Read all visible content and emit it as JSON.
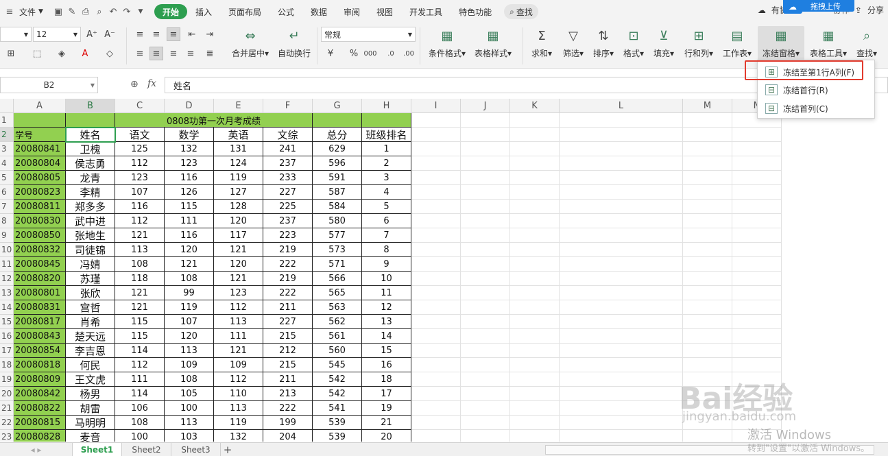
{
  "menubar": {
    "file_label": "文件",
    "tabs": [
      "开始",
      "插入",
      "页面布局",
      "公式",
      "数据",
      "审阅",
      "视图",
      "开发工具",
      "特色功能"
    ],
    "search_label": "查找",
    "collab_label": "有协",
    "share_label": "分享",
    "partial_label": "协作",
    "upload_label": "拖拽上传"
  },
  "ribbon": {
    "font_size": "12",
    "number_format": "常规",
    "merge_label": "合并居中",
    "wrap_label": "自动换行",
    "cond_format_label": "条件格式",
    "table_style_label": "表格样式",
    "sum_label": "求和",
    "filter_label": "筛选",
    "sort_label": "排序",
    "format_label": "格式",
    "fill_label": "填充",
    "rowcol_label": "行和列",
    "sheet_label": "工作表",
    "freeze_label": "冻结窗格",
    "tools_label": "表格工具",
    "find_label": "查找",
    "currency": "¥",
    "percent": "%",
    "thousands": "000"
  },
  "formula_bar": {
    "cell_ref": "B2",
    "fx": "fx",
    "content": "姓名"
  },
  "dropdown": {
    "items": [
      "冻结至第1行A列(F)",
      "冻结首行(R)",
      "冻结首列(C)"
    ]
  },
  "columns": [
    "A",
    "B",
    "C",
    "D",
    "E",
    "F",
    "G",
    "H",
    "I",
    "J",
    "K",
    "L",
    "M",
    "N"
  ],
  "sheet": {
    "title": "0808功第一次月考成绩",
    "headers": [
      "学号",
      "姓名",
      "语文",
      "数学",
      "英语",
      "文综",
      "总分",
      "班级排名"
    ],
    "rows": [
      [
        "20080841",
        "卫槐",
        "125",
        "132",
        "131",
        "241",
        "629",
        "1"
      ],
      [
        "20080804",
        "侯志勇",
        "112",
        "123",
        "124",
        "237",
        "596",
        "2"
      ],
      [
        "20080805",
        "龙青",
        "123",
        "116",
        "119",
        "233",
        "591",
        "3"
      ],
      [
        "20080823",
        "李精",
        "107",
        "126",
        "127",
        "227",
        "587",
        "4"
      ],
      [
        "20080811",
        "郑多多",
        "116",
        "115",
        "128",
        "225",
        "584",
        "5"
      ],
      [
        "20080830",
        "武中进",
        "112",
        "111",
        "120",
        "237",
        "580",
        "6"
      ],
      [
        "20080850",
        "张地生",
        "121",
        "116",
        "117",
        "223",
        "577",
        "7"
      ],
      [
        "20080832",
        "司徒锦",
        "113",
        "120",
        "121",
        "219",
        "573",
        "8"
      ],
      [
        "20080845",
        "冯婧",
        "108",
        "121",
        "120",
        "222",
        "571",
        "9"
      ],
      [
        "20080820",
        "苏瑾",
        "118",
        "108",
        "121",
        "219",
        "566",
        "10"
      ],
      [
        "20080801",
        "张欣",
        "121",
        "99",
        "123",
        "222",
        "565",
        "11"
      ],
      [
        "20080831",
        "宫哲",
        "121",
        "119",
        "112",
        "211",
        "563",
        "12"
      ],
      [
        "20080817",
        "肖希",
        "115",
        "107",
        "113",
        "227",
        "562",
        "13"
      ],
      [
        "20080843",
        "楚天远",
        "115",
        "120",
        "111",
        "215",
        "561",
        "14"
      ],
      [
        "20080854",
        "李吉恩",
        "114",
        "113",
        "121",
        "212",
        "560",
        "15"
      ],
      [
        "20080818",
        "何民",
        "112",
        "109",
        "109",
        "215",
        "545",
        "16"
      ],
      [
        "20080809",
        "王文虎",
        "111",
        "108",
        "112",
        "211",
        "542",
        "18"
      ],
      [
        "20080842",
        "杨男",
        "114",
        "105",
        "110",
        "213",
        "542",
        "17"
      ],
      [
        "20080822",
        "胡雷",
        "106",
        "100",
        "113",
        "222",
        "541",
        "19"
      ],
      [
        "20080815",
        "马明明",
        "108",
        "113",
        "119",
        "199",
        "539",
        "21"
      ],
      [
        "20080828",
        "麦音",
        "100",
        "103",
        "132",
        "204",
        "539",
        "20"
      ]
    ]
  },
  "sheet_tabs": [
    "Sheet1",
    "Sheet2",
    "Sheet3"
  ],
  "watermark": {
    "line1": "Bai经验",
    "line2": "jingyan.baidu.com",
    "activate1": "激活 Windows",
    "activate2": "转到\"设置\"以激活 Windows。"
  }
}
